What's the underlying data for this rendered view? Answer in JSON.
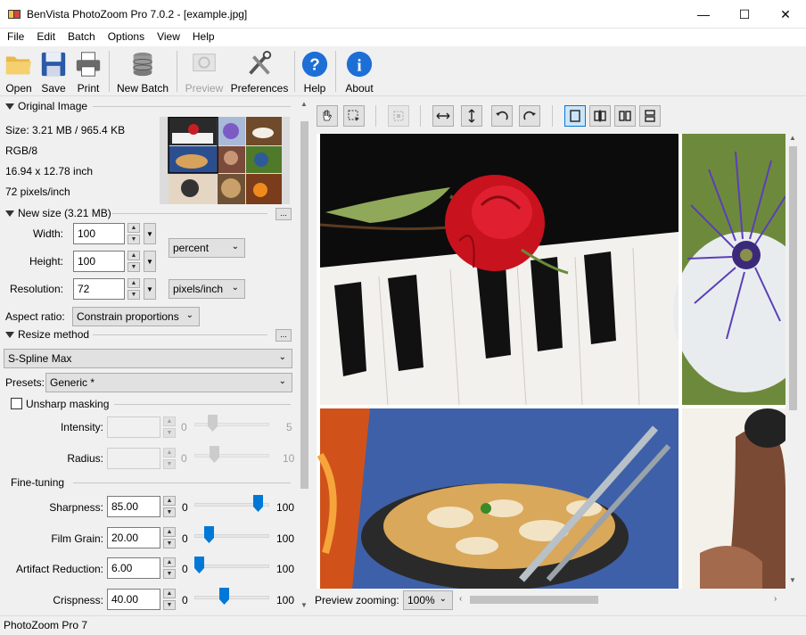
{
  "window": {
    "title": "BenVista PhotoZoom Pro 7.0.2 - [example.jpg]",
    "minimize_glyph": "—",
    "maximize_glyph": "☐",
    "close_glyph": "✕"
  },
  "menu": [
    "File",
    "Edit",
    "Batch",
    "Options",
    "View",
    "Help"
  ],
  "toolbar": {
    "open": "Open",
    "save": "Save",
    "print": "Print",
    "new_batch": "New Batch",
    "preview": "Preview",
    "preferences": "Preferences",
    "help": "Help",
    "about": "About"
  },
  "original_image": {
    "header": "Original Image",
    "size": "Size: 3.21 MB / 965.4 KB",
    "mode": "RGB/8",
    "dimensions": "16.94 x 12.78 inch",
    "resolution": "72 pixels/inch"
  },
  "new_size": {
    "header": "New size (3.21 MB)",
    "more_button": "...",
    "width_label": "Width:",
    "width_value": "100",
    "height_label": "Height:",
    "height_value": "100",
    "resolution_label": "Resolution:",
    "resolution_value": "72",
    "unit_size": "percent",
    "unit_resolution": "pixels/inch",
    "aspect_label": "Aspect ratio:",
    "aspect_value": "Constrain proportions"
  },
  "resize_method": {
    "header": "Resize method",
    "more_button": "...",
    "method": "S-Spline Max",
    "presets_label": "Presets:",
    "presets_value": "Generic *"
  },
  "unsharp": {
    "label": "Unsharp masking",
    "checked": false,
    "intensity_label": "Intensity:",
    "intensity_min": "0",
    "intensity_max": "5",
    "radius_label": "Radius:",
    "radius_min": "0",
    "radius_max": "10"
  },
  "fine_tuning": {
    "header": "Fine-tuning",
    "sharpness_label": "Sharpness:",
    "sharpness_value": "85.00",
    "film_grain_label": "Film Grain:",
    "film_grain_value": "20.00",
    "artifact_label": "Artifact Reduction:",
    "artifact_value": "6.00",
    "crispness_label": "Crispness:",
    "crispness_value": "40.00",
    "min": "0",
    "max": "100",
    "slider_levels": {
      "sharpness": 0.85,
      "film_grain": 0.2,
      "artifact": 0.06,
      "crispness": 0.4
    }
  },
  "preview": {
    "zoom_label": "Preview zooming:",
    "zoom_value": "100%"
  },
  "status": "PhotoZoom Pro 7",
  "colors": {
    "accent": "#0078d7",
    "slider_thumb": "#0078d7",
    "help_icon": "#1d6fd6"
  }
}
